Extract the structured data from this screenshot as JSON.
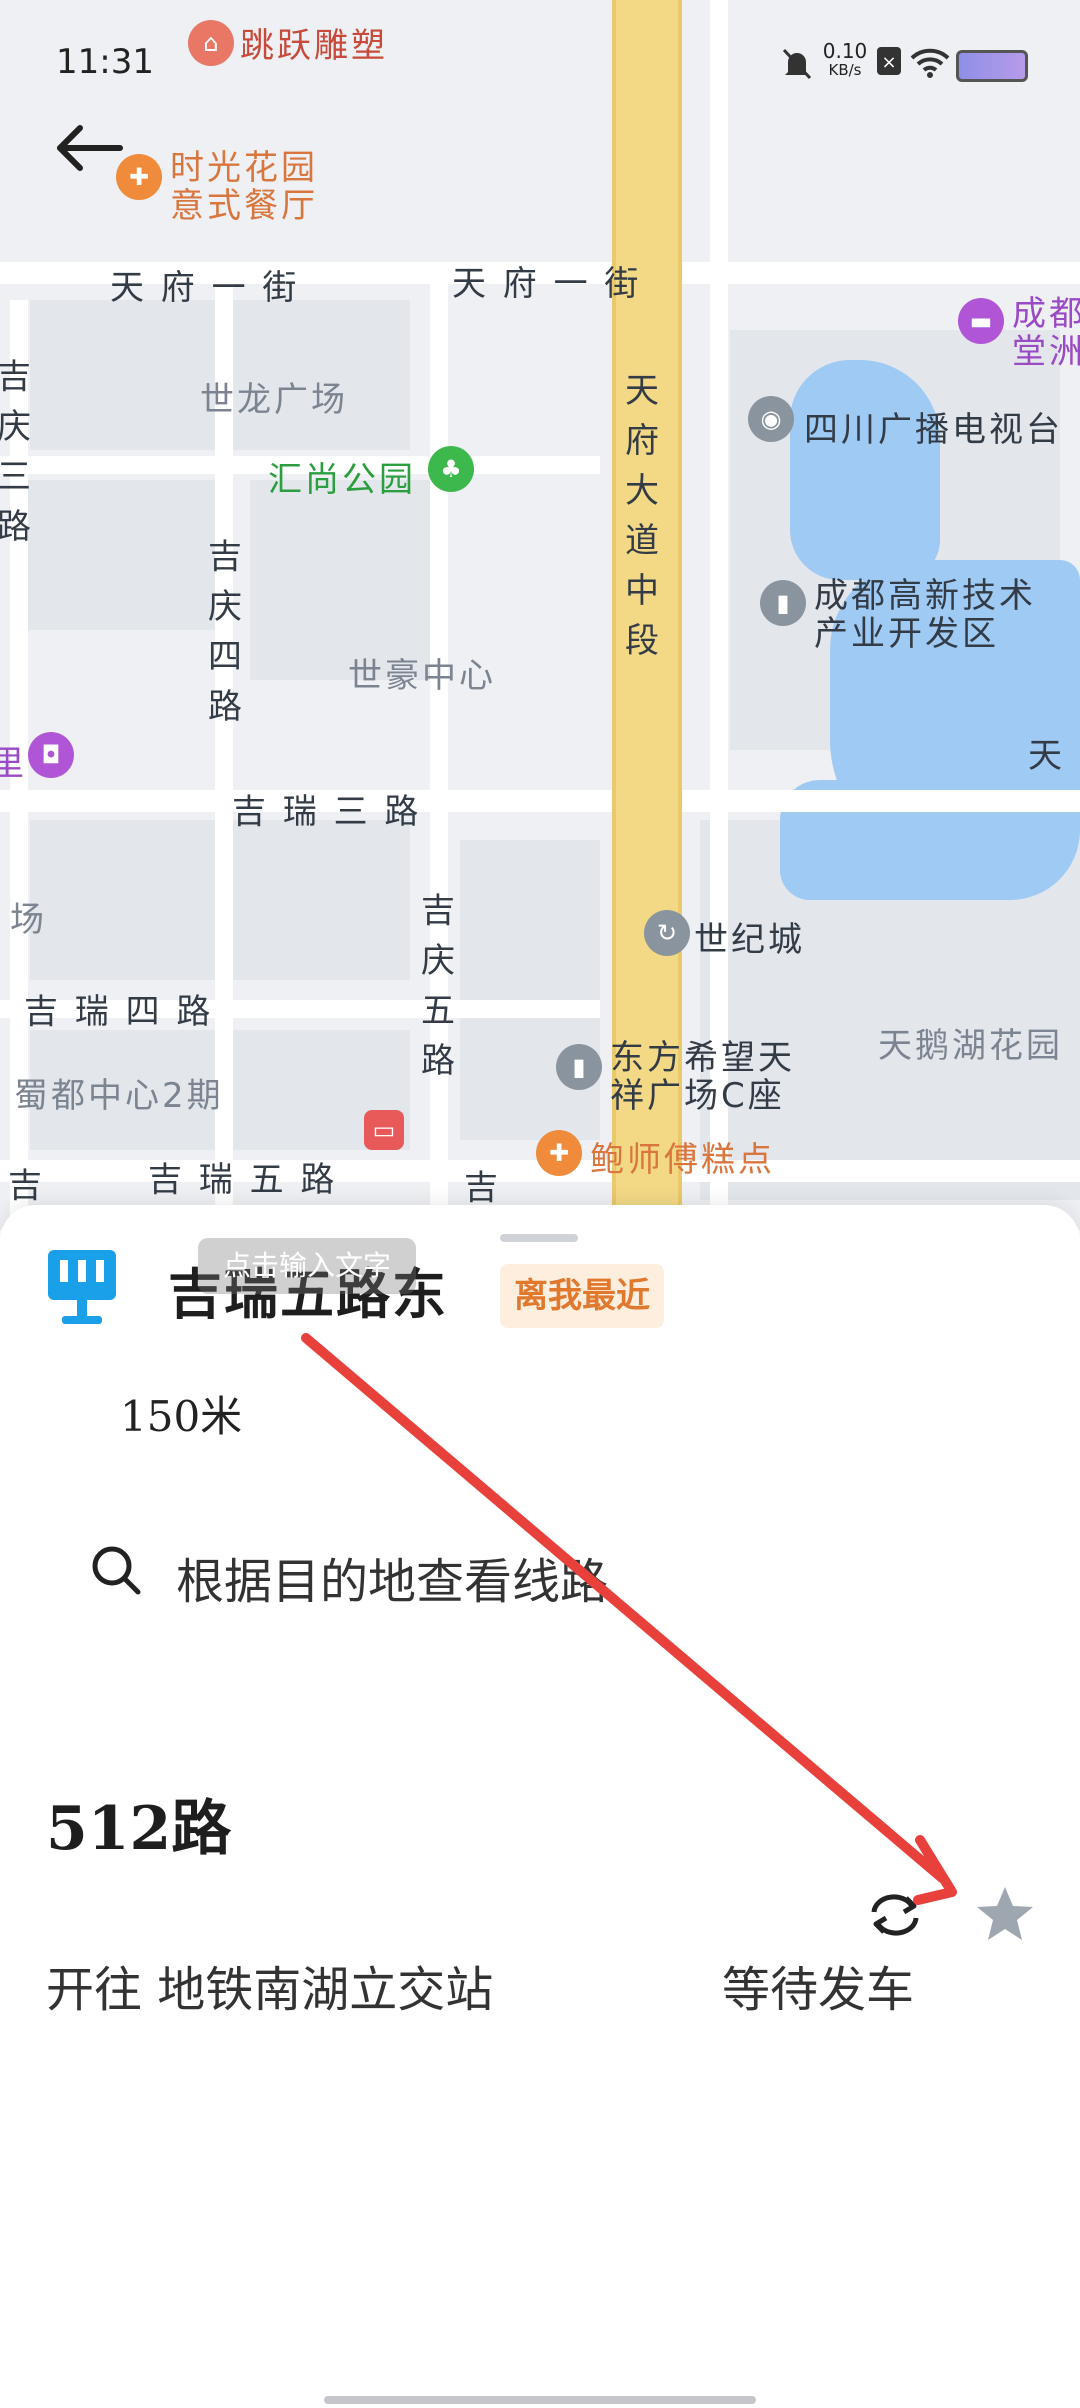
{
  "status_bar": {
    "time": "11:31",
    "net_speed_value": "0.10",
    "net_speed_unit": "KB/s"
  },
  "map": {
    "labels": {
      "tiaoyue": "跳跃雕塑",
      "shiguang_1": "时光花园",
      "shiguang_2": "意式餐厅",
      "tianfu1_left": "天 府 一 街",
      "tianfu1_right": "天 府 一 街",
      "chengdu_hotel_1": "成都",
      "chengdu_hotel_2": "堂洲",
      "shilong": "世龙广场",
      "tianfu_ave": "天府大道中段",
      "sichuan_tv": "四川广播电视台",
      "huishang_park": "汇尚公园",
      "jiqing3": "吉庆三路",
      "jiqing4": "吉庆四路",
      "gaoxin_1": "成都高新技术",
      "gaoxin_2": "产业开发区",
      "shihao": "世豪中心",
      "tian_edge": "天",
      "jirui3": "吉 瑞 三 路",
      "shiji_city": "世纪城",
      "chang": "场",
      "jirui4": "吉 瑞 四 路",
      "jiqing5": "吉庆五路",
      "dongfang_1": "东方希望天",
      "dongfang_2": "祥广场C座",
      "tiane": "天鹅湖花园",
      "shudu": "蜀都中心2期",
      "baoshi": "鲍师傅糕点",
      "jirui5": "吉 瑞 五 路",
      "ji_left": "吉",
      "ji_mid": "吉",
      "li_edge": "里"
    }
  },
  "sheet": {
    "tooltip": "点击输入文字",
    "stop_name": "吉瑞五路东",
    "nearest_badge": "离我最近",
    "distance": "150米",
    "search_placeholder": "根据目的地查看线路",
    "route": {
      "name": "512路",
      "direction": "开往 地铁南湖立交站",
      "status": "等待发车"
    }
  },
  "colors": {
    "accent_blue": "#1aa0e8",
    "badge_orange": "#e0782d",
    "annotation_red": "#e8413c",
    "star_gray": "#9ea6b0"
  }
}
